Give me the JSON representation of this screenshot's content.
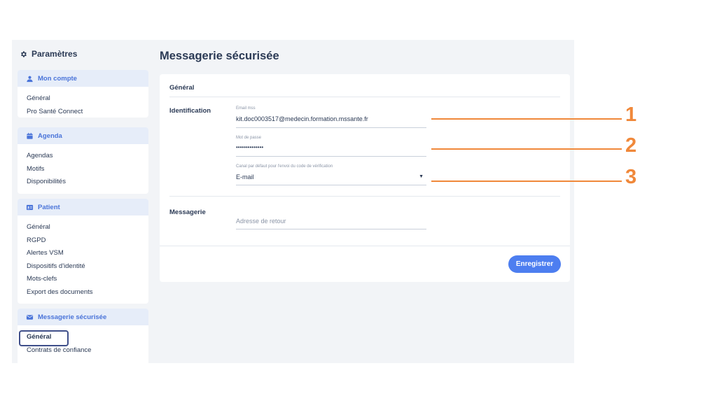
{
  "sidebar": {
    "title": "Paramètres",
    "sections": [
      {
        "label": "Mon compte",
        "icon": "user-icon",
        "items": [
          "Général",
          "Pro Santé Connect"
        ]
      },
      {
        "label": "Agenda",
        "icon": "calendar-icon",
        "items": [
          "Agendas",
          "Motifs",
          "Disponibilités"
        ]
      },
      {
        "label": "Patient",
        "icon": "id-card-icon",
        "items": [
          "Général",
          "RGPD",
          "Alertes VSM",
          "Dispositifs d'identité",
          "Mots-clefs",
          "Export des documents"
        ]
      },
      {
        "label": "Messagerie sécurisée",
        "icon": "envelope-icon",
        "items": [
          "Général",
          "Contrats de confiance"
        ],
        "active_item": "Général"
      }
    ]
  },
  "main": {
    "title": "Messagerie sécurisée",
    "section_heading": "Général",
    "identification": {
      "label": "Identification",
      "email_label": "Email mss",
      "email_value": "kit.doc0003517@medecin.formation.mssante.fr",
      "password_label": "Mot de passe",
      "password_value": "••••••••••••••",
      "channel_label": "Canal par défaut pour l'envoi du code de vérification",
      "channel_value": "E-mail"
    },
    "messagerie": {
      "label": "Messagerie",
      "return_address_placeholder": "Adresse de retour"
    },
    "save_label": "Enregistrer"
  },
  "annotations": [
    "1",
    "2",
    "3"
  ],
  "colors": {
    "accent": "#4d7ef0",
    "section_header_bg": "#e6edf9",
    "section_header_text": "#4a74d9",
    "annotation": "#f0883a",
    "text_dark": "#2b3a55"
  }
}
